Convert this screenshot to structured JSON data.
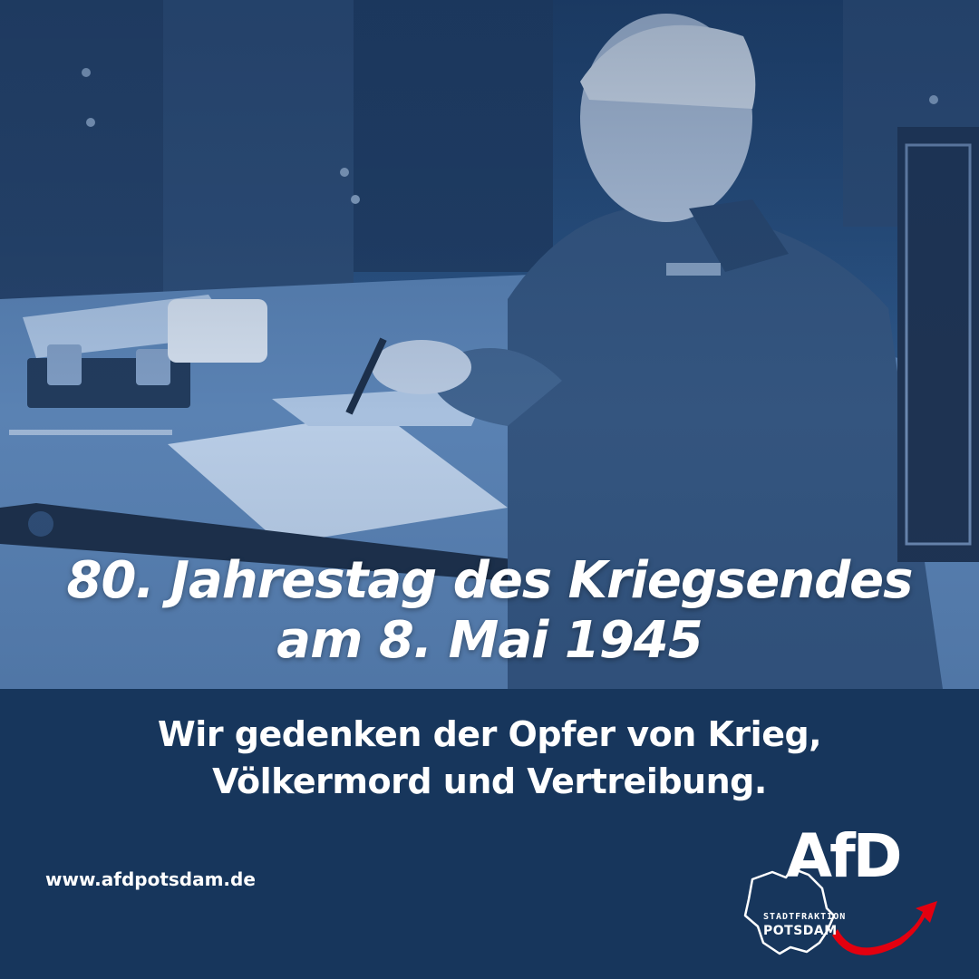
{
  "headline": {
    "line1": "80. Jahrestag des Kriegsendes",
    "line2": "am 8. Mai 1945"
  },
  "subline": {
    "line1": "Wir gedenken der Opfer von Krieg,",
    "line2": "Völkermord und Vertreibung."
  },
  "footer": {
    "url": "www.afdpotsdam.de"
  },
  "logo": {
    "wordmark": "AfD",
    "sub1": "STADTFRAKTION",
    "sub2": "POTSDAM",
    "arrow_color": "#e3000f"
  },
  "colors": {
    "panel": "#17365c",
    "photo_tint": "#2a5282",
    "text": "#ffffff"
  }
}
